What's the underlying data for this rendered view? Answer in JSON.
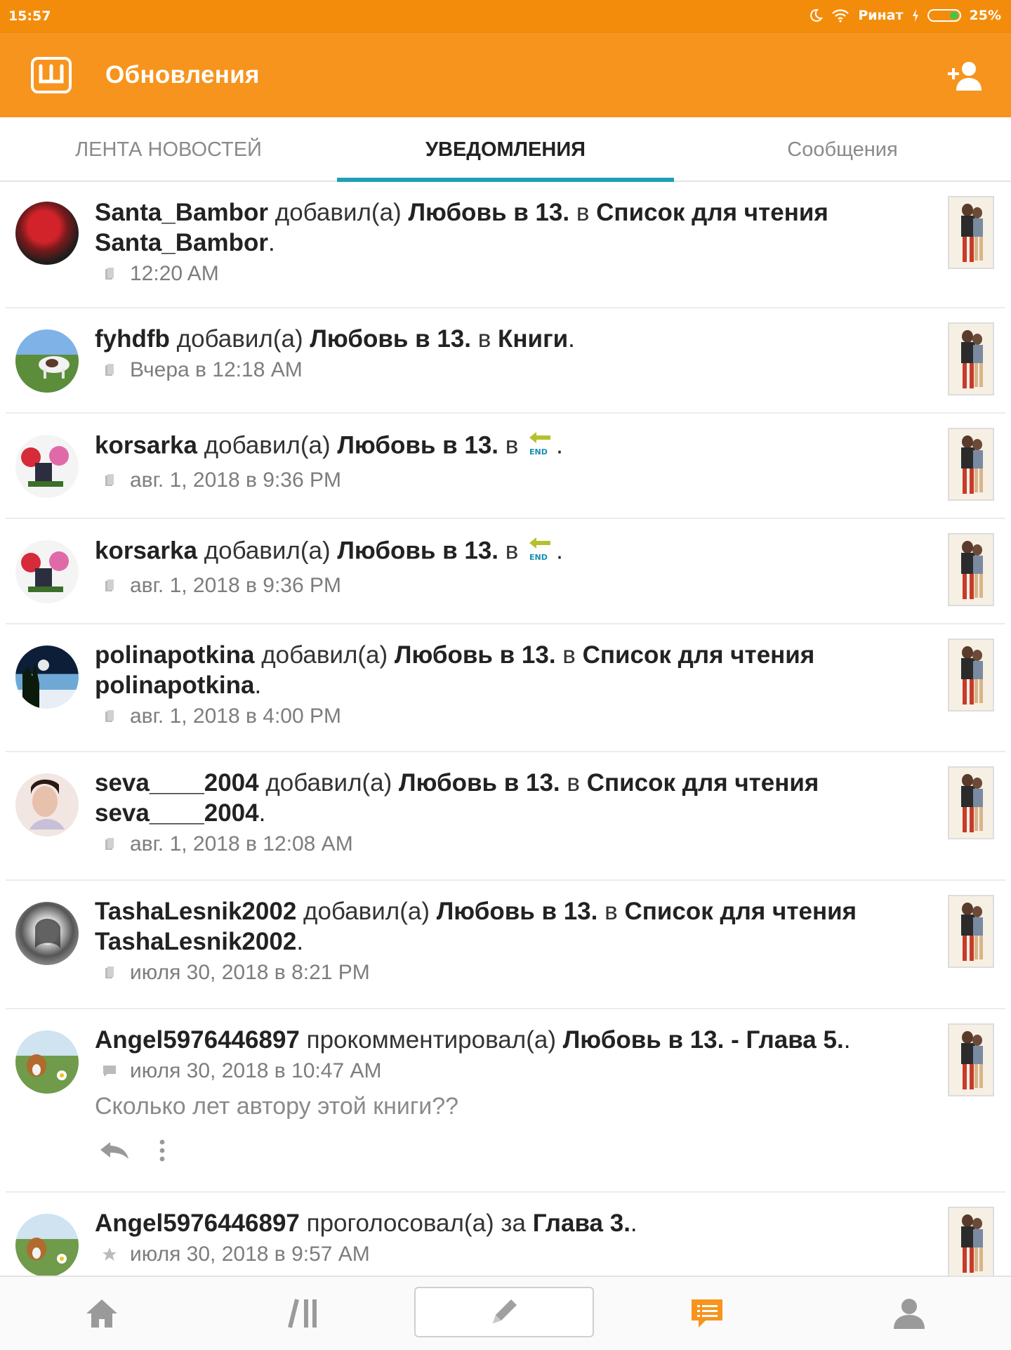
{
  "status_bar": {
    "time": "15:57",
    "carrier": "Ринат",
    "battery": "25%"
  },
  "header": {
    "title": "Обновления"
  },
  "tabs": [
    {
      "label": "ЛЕНТА НОВОСТЕЙ"
    },
    {
      "label": "УВЕДОМЛЕНИЯ"
    },
    {
      "label": "Сообщения"
    }
  ],
  "notifications": [
    {
      "user": "Santa_Bambor",
      "verb": "добавил(а)",
      "story": "Любовь в 13.",
      "prep": "в",
      "target": "Список для чтения Santa_Bambor",
      "end": ".",
      "time": "12:20 AM"
    },
    {
      "user": "fyhdfb",
      "verb": "добавил(а)",
      "story": "Любовь в 13.",
      "prep": "в",
      "target": "Книги",
      "end": ".",
      "time": "Вчера в 12:18 AM"
    },
    {
      "user": "korsarka",
      "verb": "добавил(а)",
      "story": "Любовь в 13.",
      "prep": "в",
      "end": ".",
      "badge": "END",
      "time": "авг. 1, 2018 в 9:36 PM"
    },
    {
      "user": "korsarka",
      "verb": "добавил(а)",
      "story": "Любовь в 13.",
      "prep": "в",
      "end": ".",
      "badge": "END",
      "time": "авг. 1, 2018 в 9:36 PM"
    },
    {
      "user": "polinapotkina",
      "verb": "добавил(а)",
      "story": "Любовь в 13.",
      "prep": "в",
      "target": "Список для чтения polinapotkina",
      "end": ".",
      "time": "авг. 1, 2018 в 4:00 PM"
    },
    {
      "user": "seva____2004",
      "verb": "добавил(а)",
      "story": "Любовь в 13.",
      "prep": "в",
      "target": "Список для чтения seva____2004",
      "end": ".",
      "time": "авг. 1, 2018 в 12:08 AM"
    },
    {
      "user": "TashaLesnik2002",
      "verb": "добавил(а)",
      "story": "Любовь в 13.",
      "prep": "в",
      "target": "Список для чтения TashaLesnik2002",
      "end": ".",
      "time": "июля 30, 2018 в 8:21 PM"
    },
    {
      "user": "Angel5976446897",
      "verb": "прокомментировал(а)",
      "story": "Любовь в 13. - Глава 5.",
      "end": ".",
      "time": "июля 30, 2018 в 10:47 AM",
      "comment": "Сколько лет автору этой книги??"
    },
    {
      "user": "Angel5976446897",
      "verb": "проголосовал(а) за",
      "story": "Глава 3.",
      "end": ".",
      "time": "июля 30, 2018 в 9:57 AM"
    }
  ],
  "icons": {
    "app_logo": "wattpad-logo-icon",
    "add_friend": "add-person-icon",
    "library_meta": "library-icon",
    "comment_meta": "comment-icon",
    "vote_meta": "star-icon",
    "reply": "reply-icon",
    "more": "more-vertical-icon",
    "nav": [
      "home-icon",
      "library-icon",
      "pencil-icon",
      "notifications-icon",
      "profile-icon"
    ]
  },
  "colors": {
    "brand": "#f7941d",
    "tab_indicator": "#1fa0b5",
    "active_nav": "#f7941d"
  }
}
